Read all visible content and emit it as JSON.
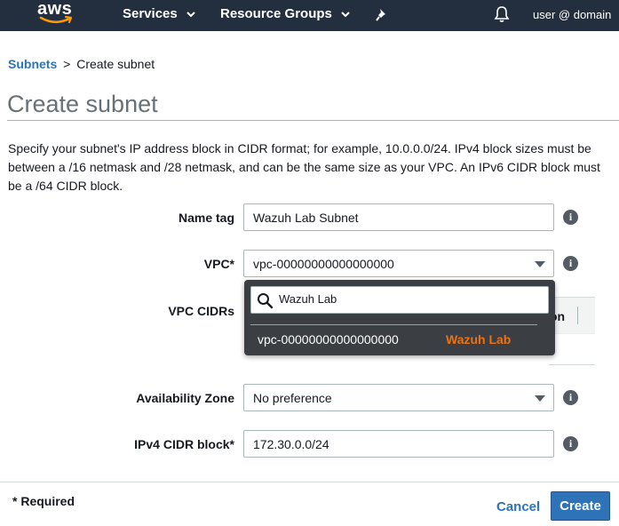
{
  "nav": {
    "logo_text": "aws",
    "services_label": "Services",
    "resource_groups_label": "Resource Groups",
    "pin_icon": "pin-icon",
    "bell_icon": "bell-icon",
    "user_label": "user @ domain",
    "background_color": "#232f3e"
  },
  "breadcrumb": {
    "parent_label": "Subnets",
    "separator": ">",
    "current_label": "Create subnet"
  },
  "page": {
    "title": "Create subnet",
    "description": "Specify your subnet's IP address block in CIDR format; for example, 10.0.0.0/24. IPv4 block sizes must be between a /16 netmask and /28 netmask, and can be the same size as your VPC. An IPv6 CIDR block must be a /64 CIDR block."
  },
  "form": {
    "name_tag": {
      "label": "Name tag",
      "value": "Wazuh Lab Subnet"
    },
    "vpc": {
      "label": "VPC*",
      "selected": "vpc-00000000000000000"
    },
    "vpc_cidrs": {
      "label": "VPC CIDRs",
      "header_tail": "on"
    },
    "availability_zone": {
      "label": "Availability Zone",
      "selected": "No preference"
    },
    "ipv4_cidr": {
      "label": "IPv4 CIDR block*",
      "value": "172.30.0.0/24"
    }
  },
  "vpc_dropdown": {
    "search_value": "Wazuh Lab",
    "options": [
      {
        "vpc_id": "vpc-00000000000000000",
        "name": "Wazuh Lab"
      }
    ],
    "highlight_color": "#ec7211"
  },
  "footer": {
    "required_note": "* Required",
    "cancel_label": "Cancel",
    "create_label": "Create",
    "primary_color": "#2e73b8"
  }
}
